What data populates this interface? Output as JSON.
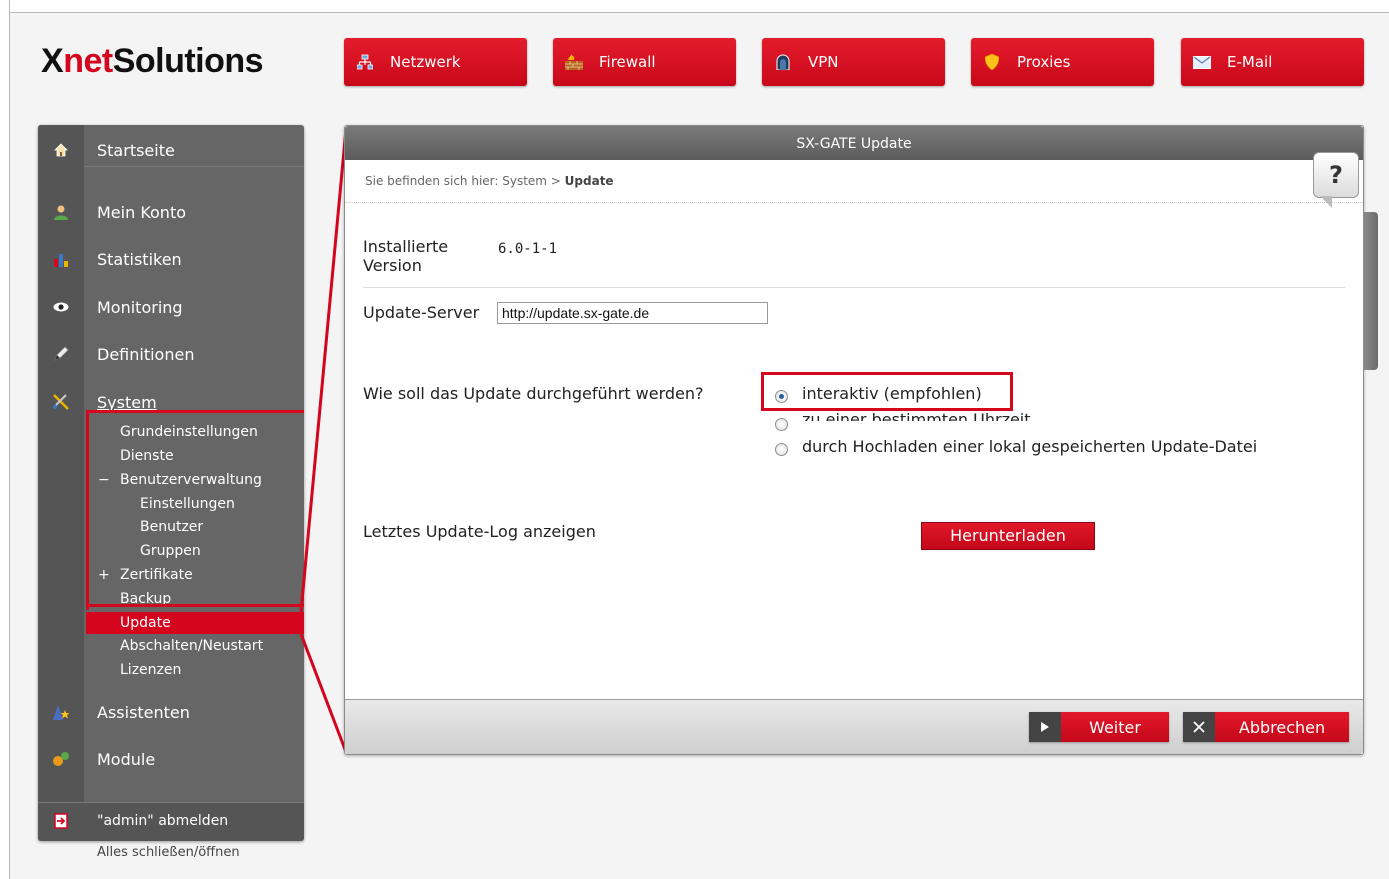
{
  "brand": {
    "logo_part1": "X",
    "logo_part2": "net",
    "logo_part3": "Solutions",
    "accent_color": "#d5051e"
  },
  "topnav": [
    {
      "label": "Netzwerk",
      "icon": "network-icon"
    },
    {
      "label": "Firewall",
      "icon": "firewall-icon"
    },
    {
      "label": "VPN",
      "icon": "vpn-icon"
    },
    {
      "label": "Proxies",
      "icon": "shield-icon"
    },
    {
      "label": "E-Mail",
      "icon": "mail-icon"
    }
  ],
  "sidebar": {
    "items": [
      {
        "label": "Startseite",
        "icon": "home-icon"
      },
      {
        "label": "Mein Konto",
        "icon": "user-icon"
      },
      {
        "label": "Statistiken",
        "icon": "bar-chart-icon"
      },
      {
        "label": "Monitoring",
        "icon": "eye-icon"
      },
      {
        "label": "Definitionen",
        "icon": "pen-icon"
      },
      {
        "label": "System",
        "icon": "tools-icon"
      },
      {
        "label": "Assistenten",
        "icon": "wizard-icon"
      },
      {
        "label": "Module",
        "icon": "modules-icon"
      }
    ],
    "system_sub": {
      "grundeinstellungen": "Grundeinstellungen",
      "dienste": "Dienste",
      "benutzerverwaltung": "Benutzerverwaltung",
      "benutzerverwaltung_toggle": "−",
      "einstellungen": "Einstellungen",
      "benutzer": "Benutzer",
      "gruppen": "Gruppen",
      "zertifikate": "Zertifikate",
      "zertifikate_toggle": "+",
      "backup": "Backup",
      "update": "Update",
      "abschalten": "Abschalten/Neustart",
      "lizenzen": "Lizenzen"
    },
    "logout": "\"admin\" abmelden",
    "close_all": "Alles schließen/öffnen"
  },
  "panel": {
    "title": "SX-GATE Update",
    "breadcrumb_prefix": "Sie befinden sich hier: System > ",
    "breadcrumb_current": "Update",
    "help": "?",
    "installed_label_1": "Installierte",
    "installed_label_2": "Version",
    "installed_value": "6.0-1-1",
    "server_label": "Update-Server",
    "server_value": "http://update.sx-gate.de",
    "mode_question": "Wie soll das Update durchgeführt werden?",
    "mode_options": [
      {
        "label": "interaktiv (empfohlen)",
        "selected": true
      },
      {
        "label": "zu einer bestimmten Uhrzeit",
        "selected": false
      },
      {
        "label": "durch Hochladen einer lokal gespeicherten Update-Datei",
        "selected": false
      }
    ],
    "log_label": "Letztes Update-Log anzeigen",
    "download_button": "Herunterladen",
    "next_button": "Weiter",
    "cancel_button": "Abbrechen"
  }
}
